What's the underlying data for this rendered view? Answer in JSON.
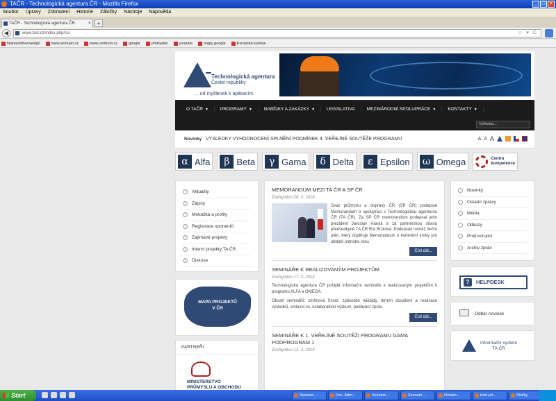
{
  "window": {
    "title": "TAČR - Technologická agentura ČR - Mozilla Firefox"
  },
  "menubar": [
    "Soubor",
    "Úpravy",
    "Zobrazení",
    "Historie",
    "Záložky",
    "Nástroje",
    "Nápověda"
  ],
  "tab": {
    "title": "TAČR - Technologická agentura ČR"
  },
  "url": "www.tacr.cz/index.php/cs/",
  "bookmarks": [
    "Nejnavštěvovanější",
    "www.seznam.cz",
    "www.centrum.cz",
    "google",
    "překladač",
    "youtube",
    "mapy google",
    "Evropská komise"
  ],
  "header": {
    "org_title": "Technologická agentura",
    "org_subtitle": "České republiky",
    "slogan": "... od myšlenek k aplikacím"
  },
  "nav": {
    "items": [
      {
        "label": "O TAČR",
        "caret": "▼"
      },
      {
        "label": "Programy",
        "caret": "▼"
      },
      {
        "label": "Nabídky a zakázky",
        "caret": "▼"
      },
      {
        "label": "Legislativa",
        "caret": ""
      },
      {
        "label": "Mezinárodní spolupráce",
        "caret": "▼"
      },
      {
        "label": "Kontakty",
        "caret": "▼"
      }
    ],
    "search_placeholder": "Vyhledat..."
  },
  "newsbar": {
    "label": "Novinky",
    "headline": "Výsledky vyhodnocení splnění podmínek 4. veřejné soutěže programu",
    "font_small": "A",
    "font_medium": "A",
    "font_large": "A"
  },
  "programs": [
    {
      "symbol": "α",
      "name": "Alfa"
    },
    {
      "symbol": "β",
      "name": "Beta"
    },
    {
      "symbol": "γ",
      "name": "Gama"
    },
    {
      "symbol": "δ",
      "name": "Delta"
    },
    {
      "symbol": "ε",
      "name": "Epsilon"
    },
    {
      "symbol": "ω",
      "name": "Omega"
    }
  ],
  "centra": {
    "line1": "Centra",
    "line2": "kompetence"
  },
  "left_menu": [
    "Aktuality",
    "Zápisy",
    "Metodika a profily",
    "Registrace oponentů",
    "Zajímavé projekty",
    "Interní projekty TA ČR",
    "Diskuse"
  ],
  "map": {
    "line1": "MAPA PROJEKTŮ",
    "line2": "V ČR"
  },
  "partners": {
    "heading": "Partneři",
    "mpo_line1": "Ministerstvo",
    "mpo_line2": "průmyslu a obchodu"
  },
  "articles": [
    {
      "title": "Memorandum mezi TA ČR a SP ČR",
      "date": "Zveřejněno 20. 2. 2014",
      "body": "Svaz průmyslu a dopravy ČR (SP ČR) podepsal Memorandum o spolupráci s Technologickou agenturou ČR (TA ČR). Za SP ČR memorandum podepsal jeho prezident Jaroslav Hanák a za partnerskou stranu předsedkyně TA ČR Rut Bízková. Podepsali rovněž Akční plán, který doplňuje Memorandum o konkrétní kroky pro období jednoho roku.",
      "more": "Číst dál..."
    },
    {
      "title": "Semináře k realizovaným projektům",
      "date": "Zveřejněno 17. 2. 2014",
      "body1": "Technologická agentura ČR pořádá informační semináře k realizovaným projektům k programu ALFA a OMEGA.",
      "body2": "Obsah seminářů: změnová řízení, způsobilé náklady, termín dosažení a realizace výsledků, smluvní vs. kolaborativní výzkum, podávání zpráv.",
      "more": "Číst dál..."
    },
    {
      "title": "Semináře k 1. veřejné soutěži programu GAMA podprogram 1",
      "date": "Zveřejněno 14. 2. 2014"
    }
  ],
  "right_menu": [
    "Novinky",
    "Ostatní zprávy",
    "Média",
    "Odkazy",
    "Proti korupci",
    "Archiv zpráv"
  ],
  "helpdesk": {
    "label": "HELPDESK"
  },
  "newsletter": {
    "label": "Odběr novinek"
  },
  "infosys": {
    "line1": "Informační systém",
    "line2": "TA ČR"
  },
  "taskbar": {
    "start": "Start",
    "tasks": [
      "Seznam ...",
      "Doc. Adm...",
      "Seznam ...",
      "Seznam ...",
      "Oznám...",
      "tracl.pd...",
      "Složky",
      "Odeslán..."
    ]
  }
}
